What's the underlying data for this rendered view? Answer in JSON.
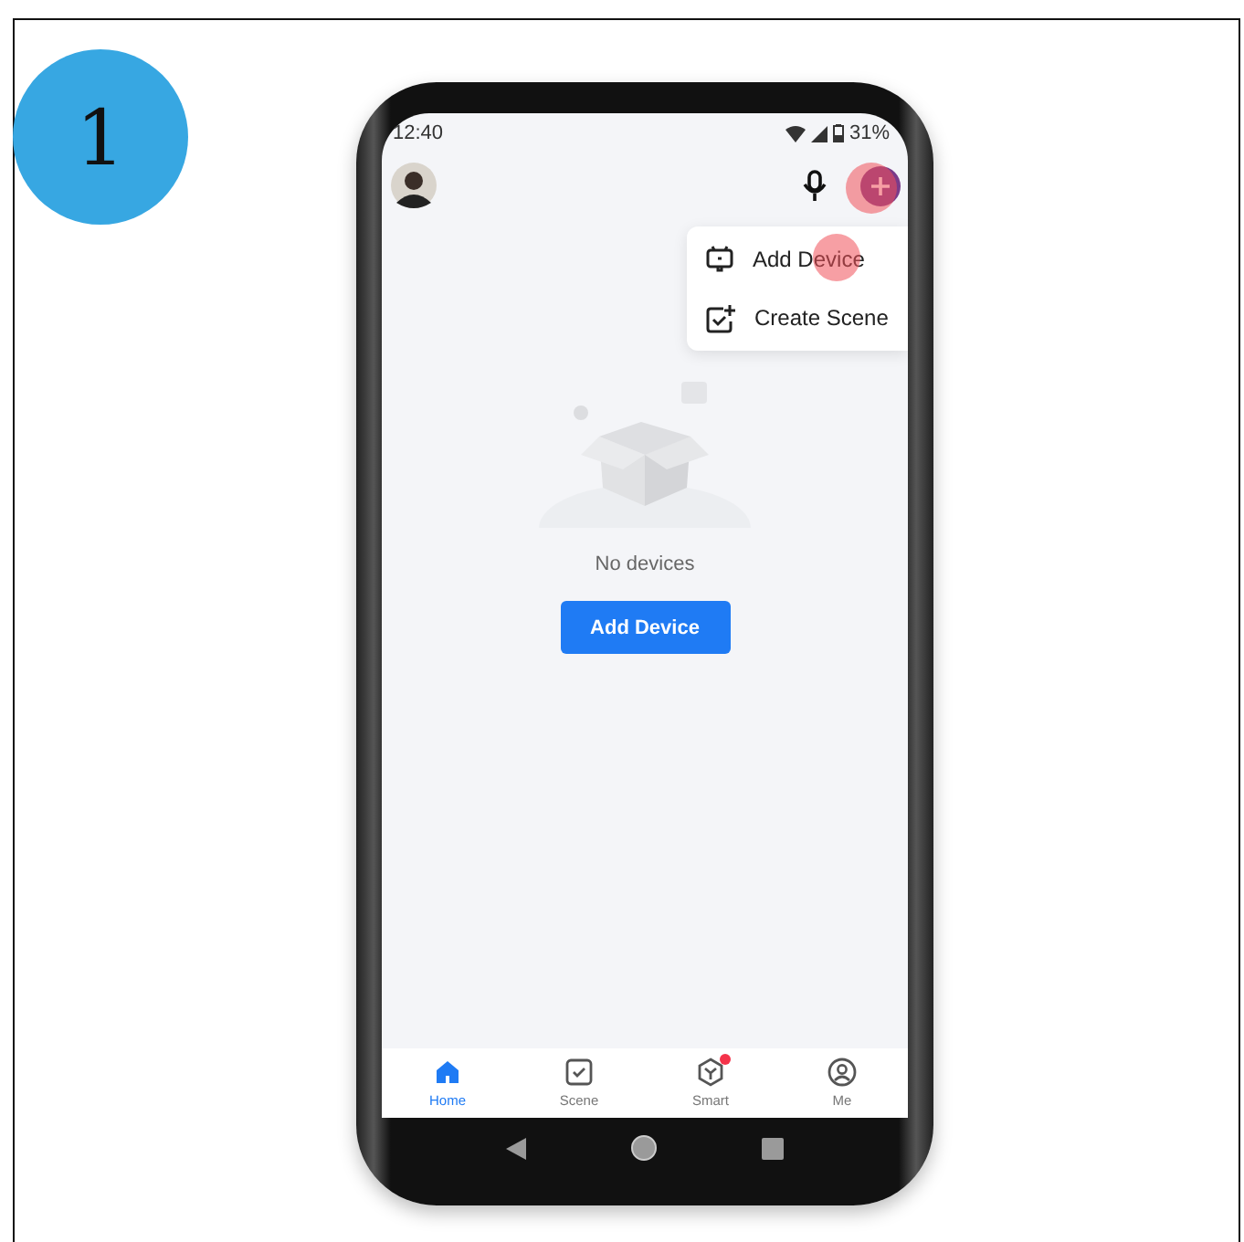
{
  "step_badge": "1",
  "status_bar": {
    "time": "12:40",
    "battery": "31%"
  },
  "add_button": {
    "touched": true
  },
  "menu": [
    {
      "kind": "device",
      "label": "Add Device",
      "touched": true
    },
    {
      "kind": "scene",
      "label": "Create Scene",
      "touched": false
    }
  ],
  "empty_state": {
    "message": "No devices",
    "button": "Add Device"
  },
  "tabs": [
    {
      "kind": "home",
      "label": "Home",
      "selected": true,
      "badge": false
    },
    {
      "kind": "scene",
      "label": "Scene",
      "selected": false,
      "badge": false
    },
    {
      "kind": "smart",
      "label": "Smart",
      "selected": false,
      "badge": true
    },
    {
      "kind": "me",
      "label": "Me",
      "selected": false,
      "badge": false
    }
  ]
}
